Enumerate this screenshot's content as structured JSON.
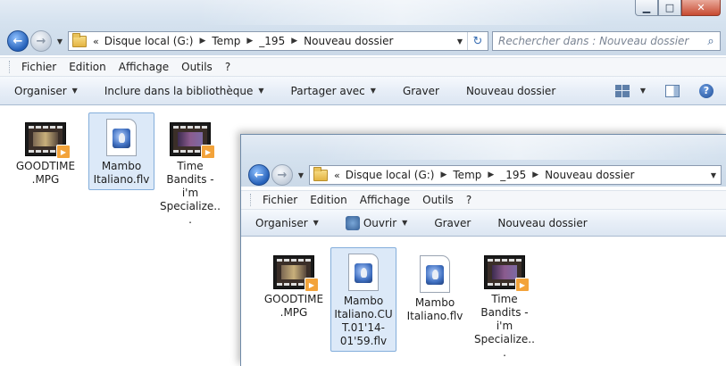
{
  "window_back": {
    "breadcrumbs": [
      "Disque local (G:)",
      "Temp",
      "_195",
      "Nouveau dossier"
    ],
    "search_placeholder": "Rechercher dans : Nouveau dossier",
    "menu": [
      "Fichier",
      "Edition",
      "Affichage",
      "Outils",
      "?"
    ],
    "commands": [
      "Organiser",
      "Inclure dans la bibliothèque",
      "Partager avec",
      "Graver",
      "Nouveau dossier"
    ],
    "files": [
      {
        "label": "GOODTIME.MPG",
        "type": "video"
      },
      {
        "label": "Mambo Italiano.flv",
        "type": "flv"
      },
      {
        "label": "Time Bandits - i'm Specialize...",
        "type": "video"
      }
    ]
  },
  "window_front": {
    "breadcrumbs": [
      "Disque local (G:)",
      "Temp",
      "_195",
      "Nouveau dossier"
    ],
    "menu": [
      "Fichier",
      "Edition",
      "Affichage",
      "Outils",
      "?"
    ],
    "commands": [
      "Organiser",
      "Ouvrir",
      "Graver",
      "Nouveau dossier"
    ],
    "files": [
      {
        "label": "GOODTIME.MPG",
        "type": "video"
      },
      {
        "label": "Mambo Italiano.CUT.01'14-01'59.flv",
        "type": "flv"
      },
      {
        "label": "Mambo Italiano.flv",
        "type": "flv"
      },
      {
        "label": "Time Bandits - i'm Specialize...",
        "type": "video"
      }
    ]
  },
  "icons": {
    "back": "back-arrow-icon",
    "forward": "forward-arrow-icon",
    "folder": "folder-icon",
    "refresh": "refresh-icon",
    "search": "search-icon",
    "help": "help-icon"
  },
  "colors": {
    "selection": "#dce9f8",
    "selection_border": "#84aedb",
    "command_bar": "#e7eef7"
  }
}
